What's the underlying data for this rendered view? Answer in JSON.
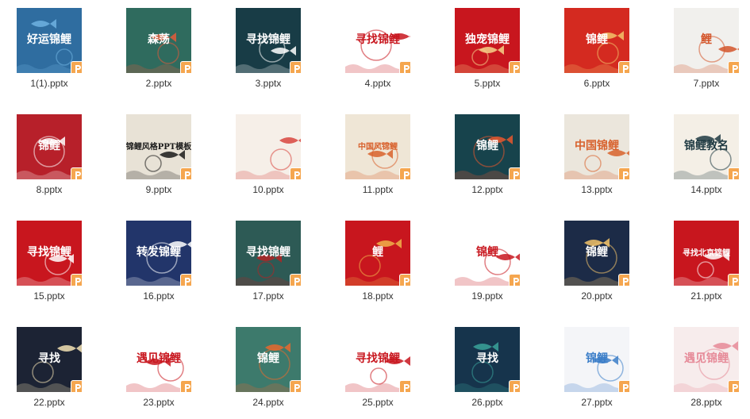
{
  "files": [
    {
      "name": "1(1).pptx",
      "bg": "#2f6da0",
      "accent": "#6fb2e0",
      "text": "好运锦鲤"
    },
    {
      "name": "2.pptx",
      "bg": "#2f6b5e",
      "accent": "#e45a3a",
      "text": "森荡"
    },
    {
      "name": "3.pptx",
      "bg": "#183c46",
      "accent": "#ffffff",
      "text": "寻找锦鲤"
    },
    {
      "name": "4.pptx",
      "bg": "#ffffff",
      "accent": "#c8161e",
      "text": "寻找锦鲤"
    },
    {
      "name": "5.pptx",
      "bg": "#c8161e",
      "accent": "#f6d28a",
      "text": "独宠锦鲤"
    },
    {
      "name": "6.pptx",
      "bg": "#d42a20",
      "accent": "#f2c36a",
      "text": "锦鲤"
    },
    {
      "name": "7.pptx",
      "bg": "#f1f0ed",
      "accent": "#d4552a",
      "text": "鲤"
    },
    {
      "name": "8.pptx",
      "bg": "#b7202a",
      "accent": "#ffffff",
      "text": "锦鲤"
    },
    {
      "name": "9.pptx",
      "bg": "#e8e2d6",
      "accent": "#1a1a1a",
      "text": "锦鲤风格PPT模板"
    },
    {
      "name": "10.pptx",
      "bg": "#f6efe8",
      "accent": "#d8453e",
      "text": ""
    },
    {
      "name": "11.pptx",
      "bg": "#efe6d6",
      "accent": "#d8612c",
      "text": "中国风锦鲤"
    },
    {
      "name": "12.pptx",
      "bg": "#17434c",
      "accent": "#e8572e",
      "text": "锦鲤"
    },
    {
      "name": "13.pptx",
      "bg": "#ebe6dc",
      "accent": "#d8612c",
      "text": "中国锦鲤"
    },
    {
      "name": "14.pptx",
      "bg": "#f4efe6",
      "accent": "#1f3a42",
      "text": "锦鲤教名"
    },
    {
      "name": "15.pptx",
      "bg": "#c8161e",
      "accent": "#ffffff",
      "text": "寻找锦鲤"
    },
    {
      "name": "16.pptx",
      "bg": "#22356a",
      "accent": "#ffffff",
      "text": "转发锦鲤"
    },
    {
      "name": "17.pptx",
      "bg": "#2d5a55",
      "accent": "#b32424",
      "text": "寻找锦鲤"
    },
    {
      "name": "18.pptx",
      "bg": "#c8161e",
      "accent": "#f0b24a",
      "text": "鲤"
    },
    {
      "name": "19.pptx",
      "bg": "#ffffff",
      "accent": "#c8161e",
      "text": "锦鲤"
    },
    {
      "name": "20.pptx",
      "bg": "#1c2b47",
      "accent": "#f2c36a",
      "text": "锦鲤"
    },
    {
      "name": "21.pptx",
      "bg": "#c8161e",
      "accent": "#ffffff",
      "text": "寻找北京锦鲤"
    },
    {
      "name": "22.pptx",
      "bg": "#1c2334",
      "accent": "#f3e2b4",
      "text": "寻找"
    },
    {
      "name": "23.pptx",
      "bg": "#ffffff",
      "accent": "#c8161e",
      "text": "遇见锦鲤"
    },
    {
      "name": "24.pptx",
      "bg": "#3d7a6c",
      "accent": "#e8692e",
      "text": "锦鲤"
    },
    {
      "name": "25.pptx",
      "bg": "#ffffff",
      "accent": "#c8161e",
      "text": "寻找锦鲤"
    },
    {
      "name": "26.pptx",
      "bg": "#16344c",
      "accent": "#3aa39a",
      "text": "寻找"
    },
    {
      "name": "27.pptx",
      "bg": "#f4f5f8",
      "accent": "#3a7dc8",
      "text": "锦鲤"
    },
    {
      "name": "28.pptx",
      "bg": "#f7ecec",
      "accent": "#e68a98",
      "text": "遇见锦鲤"
    }
  ],
  "badge_icon": "powerpoint-p-icon",
  "badge_color": "#f5a64f"
}
